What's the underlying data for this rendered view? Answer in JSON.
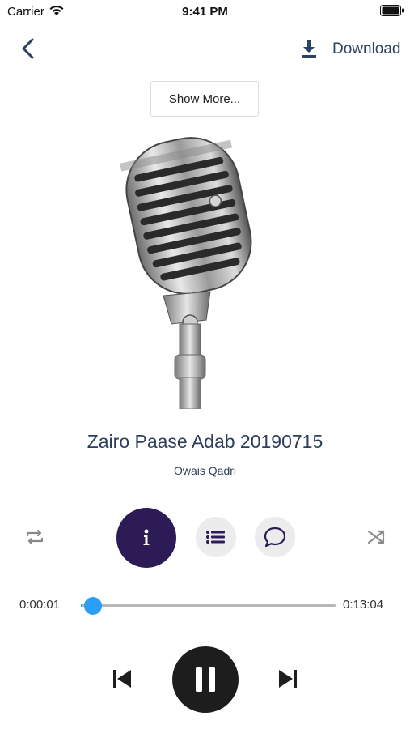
{
  "status_bar": {
    "carrier": "Carrier",
    "time": "9:41 PM",
    "wifi_icon": "wifi-icon",
    "battery_icon": "battery-icon"
  },
  "nav": {
    "back_icon": "chevron-left-icon",
    "download_icon": "download-icon",
    "download_label": "Download"
  },
  "show_more_label": "Show More...",
  "artwork_icon": "microphone-image",
  "track": {
    "title": "Zairo Paase Adab 20190715",
    "artist": "Owais Qadri"
  },
  "controls": {
    "repeat_icon": "repeat-icon",
    "info_icon": "info-icon",
    "playlist_icon": "list-icon",
    "comment_icon": "comment-icon",
    "shuffle_icon": "shuffle-icon"
  },
  "playback": {
    "elapsed": "0:00:01",
    "total": "0:13:04",
    "progress": 0.0013,
    "state": "playing"
  },
  "transport": {
    "prev_icon": "skip-back-icon",
    "pause_icon": "pause-icon",
    "next_icon": "skip-forward-icon"
  },
  "colors": {
    "accent": "#2a9df4",
    "info_button": "#2d1b56",
    "text_primary": "#2c3e5c",
    "pause_button": "#1d1d1d"
  }
}
